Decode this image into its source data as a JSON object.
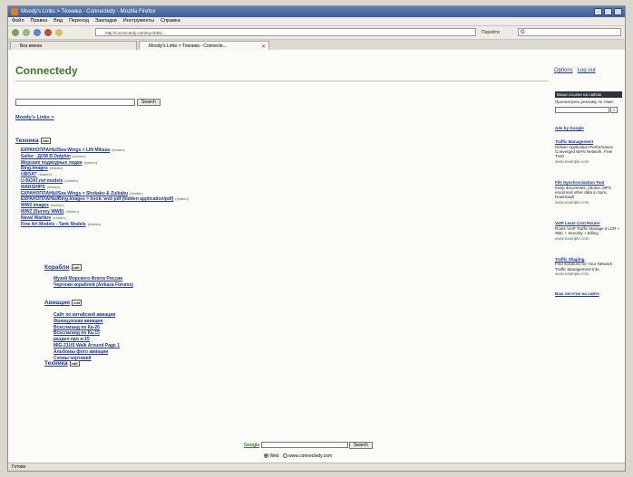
{
  "window": {
    "title": "Moody's Links > Техника - Connectedy - Mozilla Firefox"
  },
  "menu": [
    "Файл",
    "Правка",
    "Вид",
    "Переход",
    "Закладки",
    "Инструменты",
    "Справка"
  ],
  "nav": {
    "url": "http://connectedy.com/my-links/...",
    "go_label": "Перейти"
  },
  "google_box": {
    "placeholder": "G"
  },
  "tabs": [
    {
      "label": "Без имени"
    },
    {
      "label": "Moody's Links > Техника - Connecte..."
    }
  ],
  "page": {
    "brand": "Connectedy",
    "options_link": "Options",
    "logout_link": "Log out",
    "search_button": "Search",
    "breadcrumb": "Moody's Links >"
  },
  "categories": [
    {
      "title": "Техника",
      "edit": "edit",
      "links": [
        {
          "text": "ЕКРАНОПЛАНЫ/Sea Wings > LIN Mikasa",
          "hidden": "(hidden)"
        },
        {
          "text": "Sailor - ДОМ В Dolphin",
          "hidden": "(hidden)"
        },
        {
          "text": "Морские подводные лодки",
          "hidden": "(hidden)"
        },
        {
          "text": "Bing.Images",
          "hidden": "(hidden)"
        },
        {
          "text": "UBOAT",
          "hidden": "(hidden)"
        },
        {
          "text": "U-BOAT.net models",
          "hidden": "(hidden)"
        },
        {
          "text": "WARSHIPS",
          "hidden": "(hidden)"
        },
        {
          "text": "ЕКРАНОПЛАНЫ/Sea Wings > Shokaku & Zuikaku",
          "hidden": "(hidden)"
        },
        {
          "text": "ЕКРАНОПЛАНЫ/Bing.Images > book: web pdf (hidden application/pdf)",
          "hidden": "(hidden)"
        },
        {
          "text": "WW2 images",
          "hidden": "(hidden)"
        },
        {
          "text": "WW2 (Survey WWII)",
          "hidden": "(hidden)"
        },
        {
          "text": "Naval Warfare",
          "hidden": "(hidden)"
        },
        {
          "text": "Fine Art Models - Tank Models",
          "hidden": "(hidden)"
        }
      ]
    },
    {
      "title": "Корабли",
      "edit": "edit",
      "links": [
        {
          "text": "Музей Морского Флота России",
          "hidden": ""
        },
        {
          "text": "Чертежи кораблей (Airkaza Forums)",
          "hidden": ""
        }
      ]
    },
    {
      "title": "Авиация",
      "edit": "edit",
      "links": [
        {
          "text": "Сайт по китайской авиации",
          "hidden": ""
        },
        {
          "text": "Французская авиация",
          "hidden": ""
        },
        {
          "text": "Всеслаганд по Ка-26",
          "hidden": ""
        },
        {
          "text": "Всеслаганд по Ка-15",
          "hidden": ""
        },
        {
          "text": "раздел про и-15",
          "hidden": ""
        },
        {
          "text": "MIG-21US Walk Around Page 1",
          "hidden": ""
        },
        {
          "text": "Альбомы фото авиации",
          "hidden": ""
        },
        {
          "text": "Схемы чертежей",
          "hidden": ""
        }
      ]
    },
    {
      "title": "Техника",
      "edit": "edit",
      "links": []
    }
  ],
  "sidebar": {
    "header": "Ваши ссылки на сайтах",
    "prompt": "Просмотреть рекламу по теме:",
    "go": "»",
    "ads_by": "Ads by Google",
    "ads": [
      {
        "title": "Traffic Management",
        "body": "Deliver Application Performance Converged WAN Network. Free Trial!",
        "url": "www.example.com"
      },
      {
        "title": "File Synchronization Tool",
        "body": "Keep documents, photos, MP3, email and other data in Sync. Download!",
        "url": "www.example.com"
      },
      {
        "title": "VoIP Least Cost Router",
        "body": "Route VoIP Traffic Manage it LCR + SBC + Security + Billing",
        "url": "www.example.com"
      },
      {
        "title": "Traffic Shaping",
        "body": "Find Solutions for Your Network Traffic Management Info.",
        "url": "www.example.com"
      }
    ],
    "footer_link": "Ваш логотип на сайте"
  },
  "bottom": {
    "google": "Google",
    "search": "Search",
    "web": "Web",
    "site": "www.connectedy.com"
  },
  "status": "Готово"
}
